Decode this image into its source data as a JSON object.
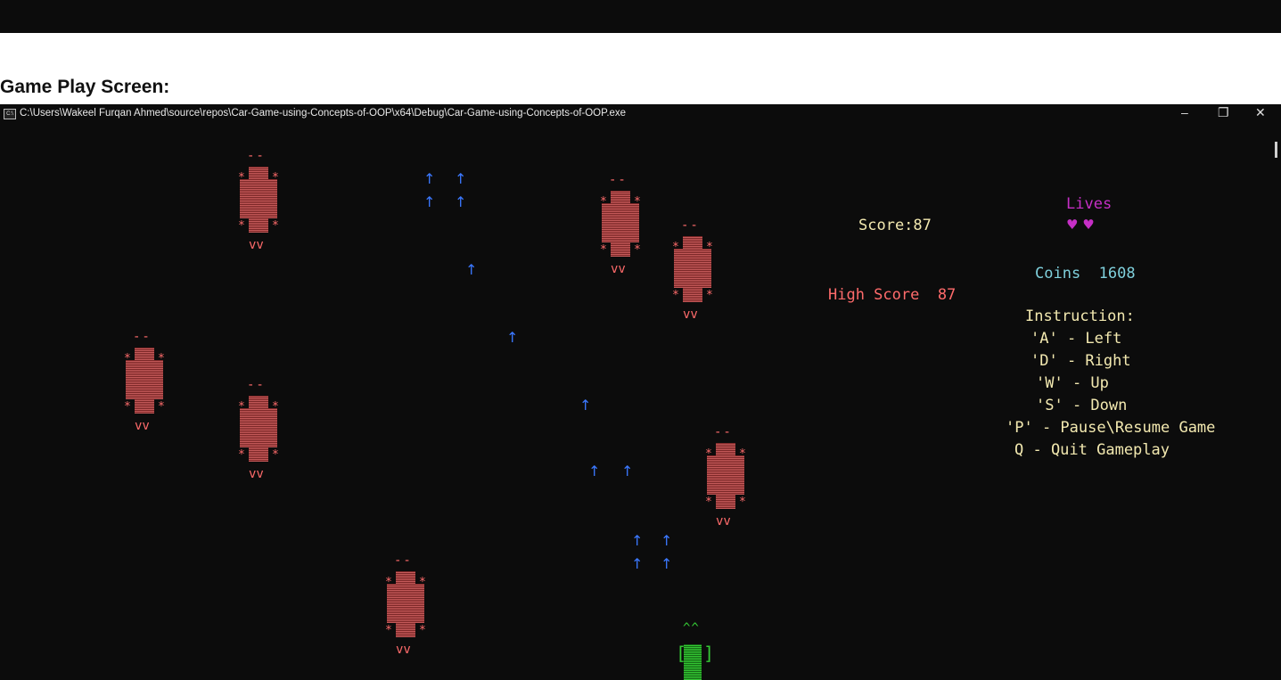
{
  "heading": "Game Play Screen:",
  "window": {
    "title": "C:\\Users\\Wakeel Furqan Ahmed\\source\\repos\\Car-Game-using-Concepts-of-OOP\\x64\\Debug\\Car-Game-using-Concepts-of-OOP.exe",
    "minimize": "–",
    "restore": "❐",
    "close": "✕"
  },
  "glyphs": {
    "enemy_top": "--",
    "enemy_bottom": "vv",
    "enemy_star": "*",
    "arrow": "↑",
    "player_top": "^^",
    "player_left": "[",
    "player_right": "]"
  },
  "hud": {
    "score": "Score:87",
    "high_score": "High Score  87",
    "lives_label": "Lives",
    "lives_hearts": "♥ ♥",
    "lives_count": 2,
    "coins": "Coins  1608",
    "instructions_title": "Instruction:",
    "instructions": [
      "'A' - Left",
      "'D' - Right",
      "'W' - Up",
      "'S' - Down",
      "'P' - Pause\\Resume Game",
      "Q - Quit Gameplay"
    ]
  },
  "colors": {
    "background": "#0c0c0c",
    "enemy": "#ff6b6b",
    "arrow": "#3b78ff",
    "player": "#35c935",
    "score": "#f3e9b0",
    "high_score": "#ff6b6b",
    "lives": "#c62fc6",
    "coins": "#7fd0dc"
  }
}
